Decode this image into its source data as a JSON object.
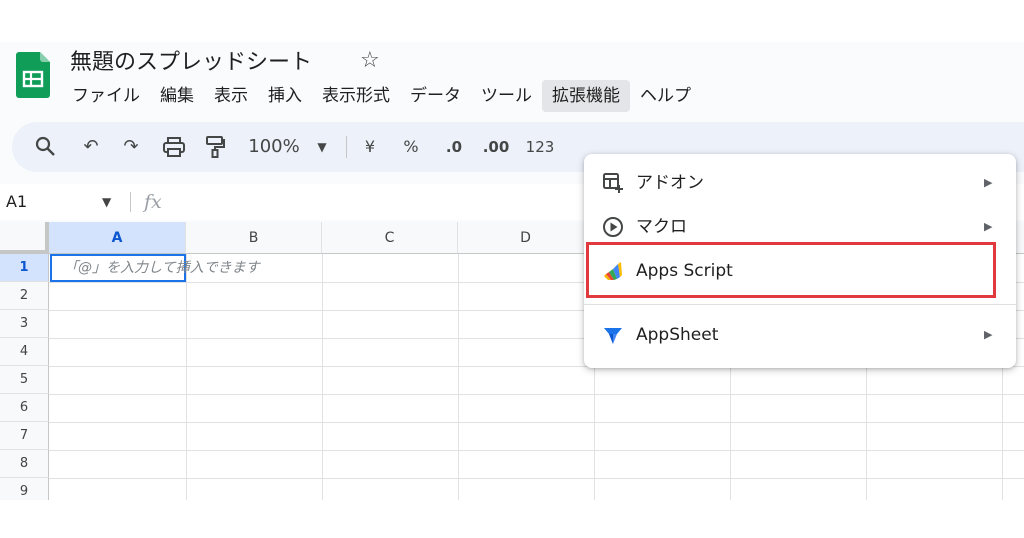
{
  "document": {
    "title": "無題のスプレッドシート"
  },
  "menubar": {
    "items": [
      "ファイル",
      "編集",
      "表示",
      "挿入",
      "表示形式",
      "データ",
      "ツール",
      "拡張機能",
      "ヘルプ"
    ],
    "active": "拡張機能"
  },
  "toolbar": {
    "zoom": "100%",
    "currency": "¥",
    "percent": "%",
    "decrease_decimal": ".0",
    "increase_decimal": ".00",
    "number_format": "123"
  },
  "formula_bar": {
    "name_box": "A1",
    "fx": "fx"
  },
  "grid": {
    "columns": [
      "A",
      "B",
      "C",
      "D"
    ],
    "rows": [
      "1",
      "2",
      "3",
      "4",
      "5",
      "6",
      "7",
      "8",
      "9"
    ],
    "selected_cell": "A1",
    "cell_hint": "「@」を入力して挿入できます"
  },
  "extensions_menu": {
    "items": [
      {
        "label": "アドオン",
        "icon": "addons-icon",
        "submenu": true
      },
      {
        "label": "マクロ",
        "icon": "macro-play-icon",
        "submenu": true
      },
      {
        "label": "Apps Script",
        "icon": "apps-script-icon",
        "submenu": false
      },
      {
        "label": "AppSheet",
        "icon": "appsheet-icon",
        "submenu": true
      }
    ],
    "highlighted": "Apps Script"
  },
  "colors": {
    "sheets_green": "#0f9d58",
    "accent_blue": "#1a73e8",
    "highlight_red": "#e03a3e",
    "toolbar_bg": "#edf2fa"
  }
}
